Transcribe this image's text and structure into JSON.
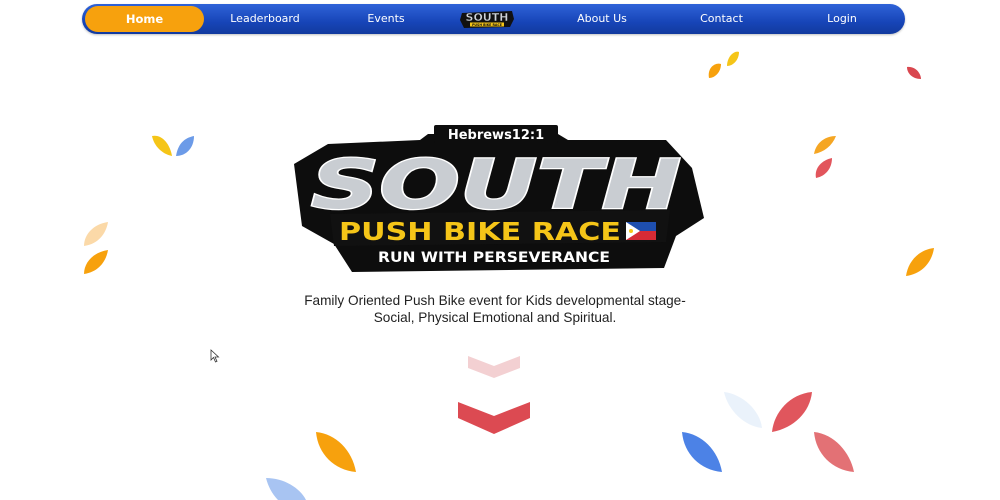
{
  "nav": {
    "items": [
      {
        "key": "home",
        "label": "Home",
        "active": true
      },
      {
        "key": "leaderboard",
        "label": "Leaderboard"
      },
      {
        "key": "events",
        "label": "Events"
      },
      {
        "key": "about",
        "label": "About Us"
      },
      {
        "key": "contact",
        "label": "Contact"
      },
      {
        "key": "login",
        "label": "Login"
      }
    ],
    "logo_text": "SOUTH",
    "logo_subtext": "PUSH BIKE RACE"
  },
  "hero": {
    "verse": "Hebrews12:1",
    "title": "SOUTH",
    "subtitle": "PUSH BIKE RACE",
    "motto": "RUN WITH PERSEVERANCE",
    "flag_icon": "philippines-flag-icon"
  },
  "tagline": {
    "line1": "Family Oriented Push Bike event for Kids developmental stage-",
    "line2": "Social, Physical Emotional and Spiritual."
  },
  "colors": {
    "nav_blue": "#1f4fc8",
    "accent_orange": "#f7a10d",
    "accent_yellow": "#f5c518",
    "accent_red": "#d9474f",
    "accent_blue": "#4c82e6"
  }
}
